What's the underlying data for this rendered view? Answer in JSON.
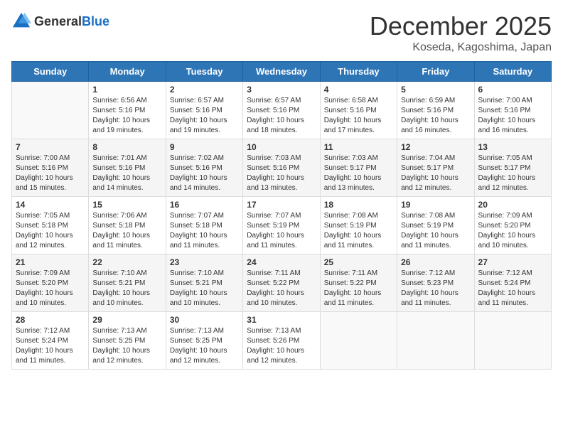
{
  "logo": {
    "general": "General",
    "blue": "Blue"
  },
  "header": {
    "month": "December 2025",
    "location": "Koseda, Kagoshima, Japan"
  },
  "weekdays": [
    "Sunday",
    "Monday",
    "Tuesday",
    "Wednesday",
    "Thursday",
    "Friday",
    "Saturday"
  ],
  "weeks": [
    [
      {
        "day": "",
        "sunrise": "",
        "sunset": "",
        "daylight": ""
      },
      {
        "day": "1",
        "sunrise": "Sunrise: 6:56 AM",
        "sunset": "Sunset: 5:16 PM",
        "daylight": "Daylight: 10 hours and 19 minutes."
      },
      {
        "day": "2",
        "sunrise": "Sunrise: 6:57 AM",
        "sunset": "Sunset: 5:16 PM",
        "daylight": "Daylight: 10 hours and 19 minutes."
      },
      {
        "day": "3",
        "sunrise": "Sunrise: 6:57 AM",
        "sunset": "Sunset: 5:16 PM",
        "daylight": "Daylight: 10 hours and 18 minutes."
      },
      {
        "day": "4",
        "sunrise": "Sunrise: 6:58 AM",
        "sunset": "Sunset: 5:16 PM",
        "daylight": "Daylight: 10 hours and 17 minutes."
      },
      {
        "day": "5",
        "sunrise": "Sunrise: 6:59 AM",
        "sunset": "Sunset: 5:16 PM",
        "daylight": "Daylight: 10 hours and 16 minutes."
      },
      {
        "day": "6",
        "sunrise": "Sunrise: 7:00 AM",
        "sunset": "Sunset: 5:16 PM",
        "daylight": "Daylight: 10 hours and 16 minutes."
      }
    ],
    [
      {
        "day": "7",
        "sunrise": "Sunrise: 7:00 AM",
        "sunset": "Sunset: 5:16 PM",
        "daylight": "Daylight: 10 hours and 15 minutes."
      },
      {
        "day": "8",
        "sunrise": "Sunrise: 7:01 AM",
        "sunset": "Sunset: 5:16 PM",
        "daylight": "Daylight: 10 hours and 14 minutes."
      },
      {
        "day": "9",
        "sunrise": "Sunrise: 7:02 AM",
        "sunset": "Sunset: 5:16 PM",
        "daylight": "Daylight: 10 hours and 14 minutes."
      },
      {
        "day": "10",
        "sunrise": "Sunrise: 7:03 AM",
        "sunset": "Sunset: 5:16 PM",
        "daylight": "Daylight: 10 hours and 13 minutes."
      },
      {
        "day": "11",
        "sunrise": "Sunrise: 7:03 AM",
        "sunset": "Sunset: 5:17 PM",
        "daylight": "Daylight: 10 hours and 13 minutes."
      },
      {
        "day": "12",
        "sunrise": "Sunrise: 7:04 AM",
        "sunset": "Sunset: 5:17 PM",
        "daylight": "Daylight: 10 hours and 12 minutes."
      },
      {
        "day": "13",
        "sunrise": "Sunrise: 7:05 AM",
        "sunset": "Sunset: 5:17 PM",
        "daylight": "Daylight: 10 hours and 12 minutes."
      }
    ],
    [
      {
        "day": "14",
        "sunrise": "Sunrise: 7:05 AM",
        "sunset": "Sunset: 5:18 PM",
        "daylight": "Daylight: 10 hours and 12 minutes."
      },
      {
        "day": "15",
        "sunrise": "Sunrise: 7:06 AM",
        "sunset": "Sunset: 5:18 PM",
        "daylight": "Daylight: 10 hours and 11 minutes."
      },
      {
        "day": "16",
        "sunrise": "Sunrise: 7:07 AM",
        "sunset": "Sunset: 5:18 PM",
        "daylight": "Daylight: 10 hours and 11 minutes."
      },
      {
        "day": "17",
        "sunrise": "Sunrise: 7:07 AM",
        "sunset": "Sunset: 5:19 PM",
        "daylight": "Daylight: 10 hours and 11 minutes."
      },
      {
        "day": "18",
        "sunrise": "Sunrise: 7:08 AM",
        "sunset": "Sunset: 5:19 PM",
        "daylight": "Daylight: 10 hours and 11 minutes."
      },
      {
        "day": "19",
        "sunrise": "Sunrise: 7:08 AM",
        "sunset": "Sunset: 5:19 PM",
        "daylight": "Daylight: 10 hours and 11 minutes."
      },
      {
        "day": "20",
        "sunrise": "Sunrise: 7:09 AM",
        "sunset": "Sunset: 5:20 PM",
        "daylight": "Daylight: 10 hours and 10 minutes."
      }
    ],
    [
      {
        "day": "21",
        "sunrise": "Sunrise: 7:09 AM",
        "sunset": "Sunset: 5:20 PM",
        "daylight": "Daylight: 10 hours and 10 minutes."
      },
      {
        "day": "22",
        "sunrise": "Sunrise: 7:10 AM",
        "sunset": "Sunset: 5:21 PM",
        "daylight": "Daylight: 10 hours and 10 minutes."
      },
      {
        "day": "23",
        "sunrise": "Sunrise: 7:10 AM",
        "sunset": "Sunset: 5:21 PM",
        "daylight": "Daylight: 10 hours and 10 minutes."
      },
      {
        "day": "24",
        "sunrise": "Sunrise: 7:11 AM",
        "sunset": "Sunset: 5:22 PM",
        "daylight": "Daylight: 10 hours and 10 minutes."
      },
      {
        "day": "25",
        "sunrise": "Sunrise: 7:11 AM",
        "sunset": "Sunset: 5:22 PM",
        "daylight": "Daylight: 10 hours and 11 minutes."
      },
      {
        "day": "26",
        "sunrise": "Sunrise: 7:12 AM",
        "sunset": "Sunset: 5:23 PM",
        "daylight": "Daylight: 10 hours and 11 minutes."
      },
      {
        "day": "27",
        "sunrise": "Sunrise: 7:12 AM",
        "sunset": "Sunset: 5:24 PM",
        "daylight": "Daylight: 10 hours and 11 minutes."
      }
    ],
    [
      {
        "day": "28",
        "sunrise": "Sunrise: 7:12 AM",
        "sunset": "Sunset: 5:24 PM",
        "daylight": "Daylight: 10 hours and 11 minutes."
      },
      {
        "day": "29",
        "sunrise": "Sunrise: 7:13 AM",
        "sunset": "Sunset: 5:25 PM",
        "daylight": "Daylight: 10 hours and 12 minutes."
      },
      {
        "day": "30",
        "sunrise": "Sunrise: 7:13 AM",
        "sunset": "Sunset: 5:25 PM",
        "daylight": "Daylight: 10 hours and 12 minutes."
      },
      {
        "day": "31",
        "sunrise": "Sunrise: 7:13 AM",
        "sunset": "Sunset: 5:26 PM",
        "daylight": "Daylight: 10 hours and 12 minutes."
      },
      {
        "day": "",
        "sunrise": "",
        "sunset": "",
        "daylight": ""
      },
      {
        "day": "",
        "sunrise": "",
        "sunset": "",
        "daylight": ""
      },
      {
        "day": "",
        "sunrise": "",
        "sunset": "",
        "daylight": ""
      }
    ]
  ]
}
